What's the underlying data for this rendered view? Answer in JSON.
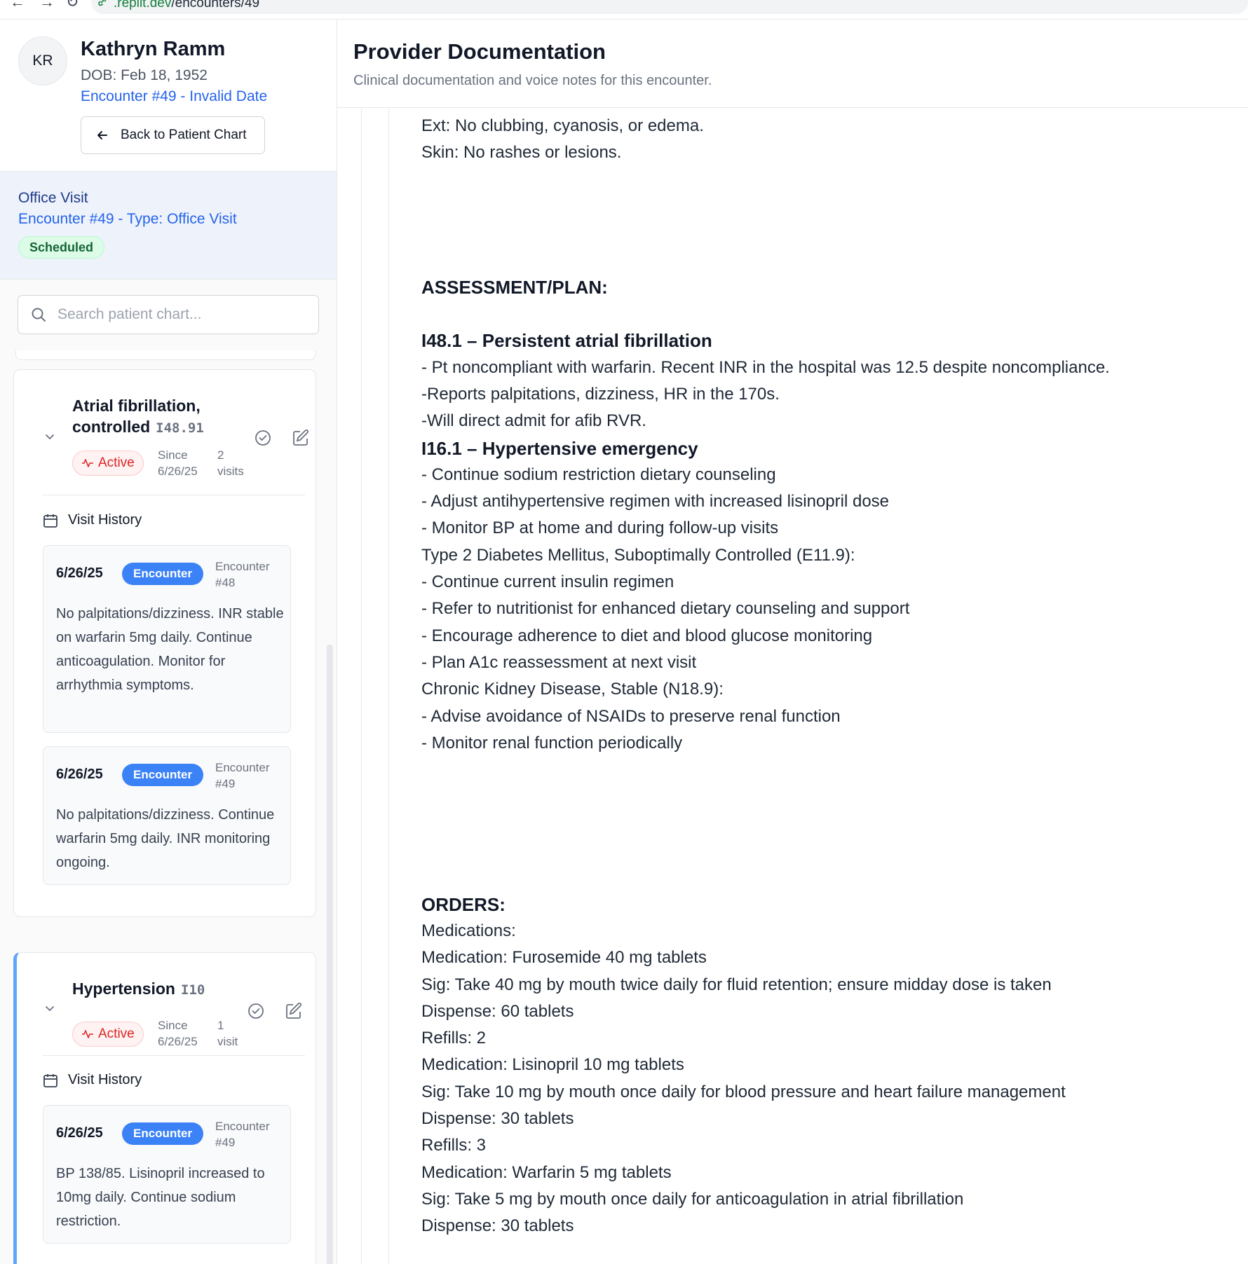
{
  "browser": {
    "url_host": ".replit.dev",
    "url_path": "/encounters/49"
  },
  "patient": {
    "initials": "KR",
    "name": "Kathryn Ramm",
    "dob": "DOB: Feb 18, 1952",
    "encounter_line": "Encounter #49 - Invalid Date",
    "back_label": "Back to Patient Chart"
  },
  "visit": {
    "title": "Office Visit",
    "subtitle": "Encounter #49 - Type: Office Visit",
    "status": "Scheduled"
  },
  "search": {
    "placeholder": "Search patient chart..."
  },
  "problems": [
    {
      "title_line1": "Atrial fibrillation,",
      "title_line2": "controlled",
      "icd": "I48.91",
      "status": "Active",
      "since_label": "Since",
      "since_date": "6/26/25",
      "visits_count": "2",
      "visits_word": "visits",
      "history_label": "Visit History",
      "visits": [
        {
          "date": "6/26/25",
          "badge": "Encounter",
          "enc_label": "Encounter",
          "enc_num": "#48",
          "note": "No palpitations/dizziness. INR stable on warfarin 5mg daily. Continue anticoagulation. Monitor for arrhythmia symptoms."
        },
        {
          "date": "6/26/25",
          "badge": "Encounter",
          "enc_label": "Encounter",
          "enc_num": "#49",
          "note": "No palpitations/dizziness. Continue warfarin 5mg daily. INR monitoring ongoing."
        }
      ]
    },
    {
      "title_line1": "Hypertension",
      "icd": "I10",
      "status": "Active",
      "since_label": "Since",
      "since_date": "6/26/25",
      "visits_count": "1",
      "visits_word": "visit",
      "history_label": "Visit History",
      "visits": [
        {
          "date": "6/26/25",
          "badge": "Encounter",
          "enc_label": "Encounter",
          "enc_num": "#49",
          "note": "BP 138/85. Lisinopril increased to 10mg daily. Continue sodium restriction."
        }
      ]
    }
  ],
  "main": {
    "title": "Provider Documentation",
    "subtitle": "Clinical documentation and voice notes for this encounter."
  },
  "document_lines": [
    {
      "text": "Ext: No clubbing, cyanosis, or edema.",
      "style": "normal"
    },
    {
      "text": "Skin: No rashes or lesions.",
      "style": "normal"
    },
    {
      "text": "",
      "style": "normal"
    },
    {
      "text": "",
      "style": "normal"
    },
    {
      "text": "",
      "style": "normal"
    },
    {
      "text": "",
      "style": "normal"
    },
    {
      "text": "ASSESSMENT/PLAN:",
      "style": "heading"
    },
    {
      "text": "",
      "style": "normal"
    },
    {
      "text": "I48.1 – Persistent atrial fibrillation",
      "style": "heading"
    },
    {
      "text": "- Pt noncompliant with warfarin. Recent INR in the hospital was 12.5 despite noncompliance.",
      "style": "normal"
    },
    {
      "text": "-Reports palpitations, dizziness, HR in the 170s.",
      "style": "normal"
    },
    {
      "text": "-Will direct admit for afib RVR.",
      "style": "normal"
    },
    {
      "text": "I16.1 – Hypertensive emergency",
      "style": "heading"
    },
    {
      "text": "- Continue sodium restriction dietary counseling",
      "style": "normal"
    },
    {
      "text": "- Adjust antihypertensive regimen with increased lisinopril dose",
      "style": "normal"
    },
    {
      "text": "- Monitor BP at home and during follow-up visits",
      "style": "normal"
    },
    {
      "text": "Type 2 Diabetes Mellitus, Suboptimally Controlled (E11.9):",
      "style": "normal"
    },
    {
      "text": "- Continue current insulin regimen",
      "style": "normal"
    },
    {
      "text": "- Refer to nutritionist for enhanced dietary counseling and support",
      "style": "normal"
    },
    {
      "text": "- Encourage adherence to diet and blood glucose monitoring",
      "style": "normal"
    },
    {
      "text": "- Plan A1c reassessment at next visit",
      "style": "normal"
    },
    {
      "text": "Chronic Kidney Disease, Stable (N18.9):",
      "style": "normal"
    },
    {
      "text": "- Advise avoidance of NSAIDs to preserve renal function",
      "style": "normal"
    },
    {
      "text": "- Monitor renal function periodically",
      "style": "normal"
    },
    {
      "text": "",
      "style": "normal"
    },
    {
      "text": "",
      "style": "normal"
    },
    {
      "text": "",
      "style": "normal"
    },
    {
      "text": "",
      "style": "normal"
    },
    {
      "text": "",
      "style": "normal"
    },
    {
      "text": "ORDERS:",
      "style": "heading"
    },
    {
      "text": "Medications:",
      "style": "normal"
    },
    {
      "text": "Medication: Furosemide 40 mg tablets",
      "style": "normal"
    },
    {
      "text": "Sig: Take 40 mg by mouth twice daily for fluid retention; ensure midday dose is taken",
      "style": "normal"
    },
    {
      "text": "Dispense: 60 tablets",
      "style": "normal"
    },
    {
      "text": "Refills: 2",
      "style": "normal"
    },
    {
      "text": "Medication: Lisinopril 10 mg tablets",
      "style": "normal"
    },
    {
      "text": "Sig: Take 10 mg by mouth once daily for blood pressure and heart failure management",
      "style": "normal"
    },
    {
      "text": "Dispense: 30 tablets",
      "style": "normal"
    },
    {
      "text": "Refills: 3",
      "style": "normal"
    },
    {
      "text": "Medication: Warfarin 5 mg tablets",
      "style": "normal"
    },
    {
      "text": "Sig: Take 5 mg by mouth once daily for anticoagulation in atrial fibrillation",
      "style": "normal"
    },
    {
      "text": "Dispense: 30 tablets",
      "style": "normal"
    }
  ],
  "colors": {
    "accent": "#2563eb",
    "encounter_badge": "#3b82f6",
    "active_badge": "#dc2626",
    "scheduled_badge": "#166534"
  }
}
